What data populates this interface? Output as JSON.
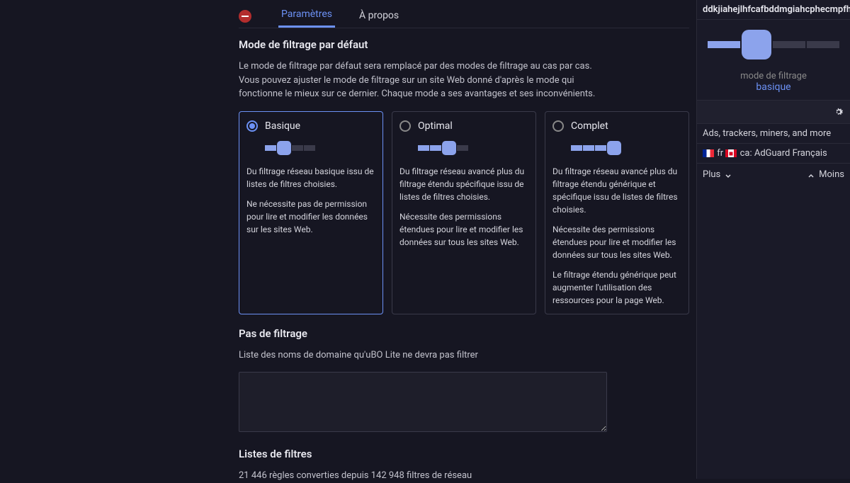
{
  "tabs": {
    "settings": "Paramètres",
    "about": "À propos"
  },
  "filtering": {
    "heading": "Mode de filtrage par défaut",
    "desc": "Le mode de filtrage par défaut sera remplacé par des modes de filtrage au cas par cas. Vous pouvez ajuster le mode de filtrage sur un site Web donné d'après le mode qui fonctionne le mieux sur ce dernier. Chaque mode a ses avantages et ses inconvénients."
  },
  "modes": {
    "basic": {
      "title": "Basique",
      "p1": "Du filtrage réseau basique issu de listes de filtres choisies.",
      "p2": "Ne nécessite pas de permission pour lire et modifier les données sur les sites Web."
    },
    "optimal": {
      "title": "Optimal",
      "p1": "Du filtrage réseau avancé plus du filtrage étendu spécifique issu de listes de filtres choisies.",
      "p2": "Nécessite des permissions étendues pour lire et modifier les données sur tous les sites Web."
    },
    "complete": {
      "title": "Complet",
      "p1": "Du filtrage réseau avancé plus du filtrage étendu générique et spécifique issu de listes de filtres choisies.",
      "p2": "Nécessite des permissions étendues pour lire et modifier les données sur tous les sites Web.",
      "p3": "Le filtrage étendu générique peut augmenter l'utilisation des ressources pour la page Web."
    }
  },
  "nofilter": {
    "heading": "Pas de filtrage",
    "desc": "Liste des noms de domaine qu'uBO Lite ne devra pas filtrer"
  },
  "lists": {
    "heading": "Listes de filtres",
    "stats": "21 446 règles converties depuis 142 948 filtres de réseau"
  },
  "sidebar": {
    "id": "ddkjiahejlhfcafbddmgiahcphecmpfh",
    "mode_label": "mode de filtrage",
    "mode_value": "basique",
    "row1": "Ads, trackers, miners, and more",
    "row2": " fr  ca: AdGuard Français",
    "plus": "Plus",
    "moins": "Moins"
  }
}
